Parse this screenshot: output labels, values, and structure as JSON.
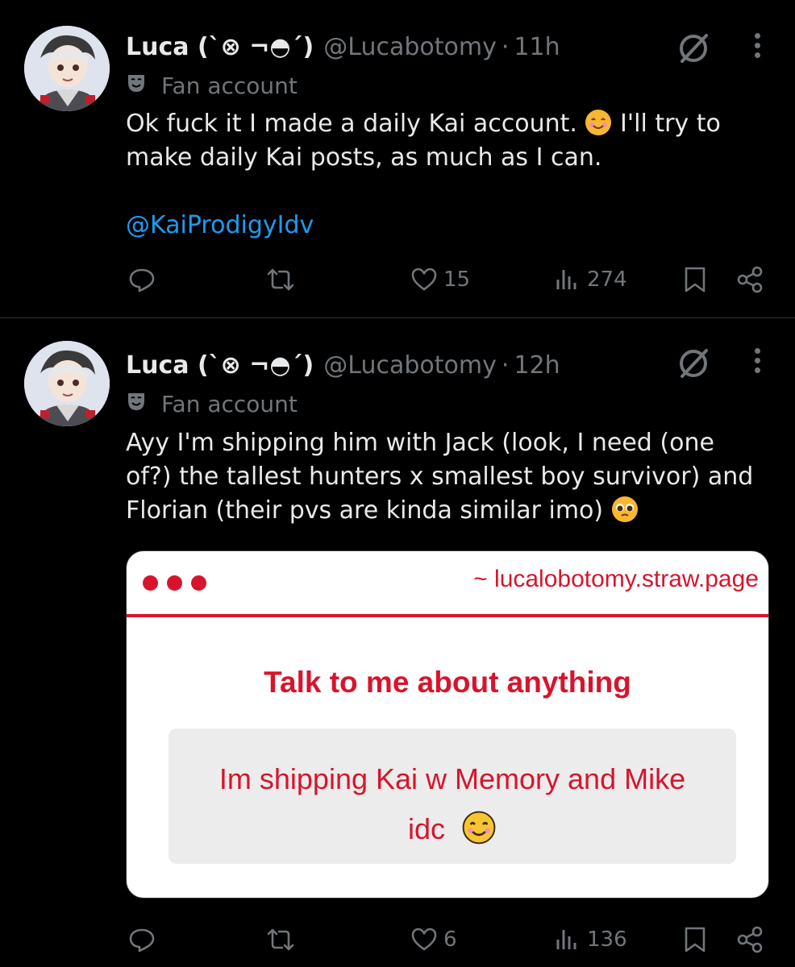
{
  "tweets": [
    {
      "author": {
        "name": "Luca (`⊗ ¬◓´)",
        "handle": "@Lucabotomy",
        "label": "Fan account"
      },
      "time": "11h",
      "text_line1": "Ok fuck it I made a daily Kai account.",
      "text_line1b": "I'll try to",
      "text_line2": "make daily Kai posts, as much as I can.",
      "mention": "@KaiProdigyIdv",
      "stats": {
        "replies": "",
        "reposts": "",
        "likes": "15",
        "views": "274"
      }
    },
    {
      "author": {
        "name": "Luca (`⊗ ¬◓´)",
        "handle": "@Lucabotomy",
        "label": "Fan account"
      },
      "time": "12h",
      "text_line1": "Ayy I'm shipping him with Jack (look, I need (one",
      "text_line2": "of?) the tallest hunters x smallest boy survivor) and",
      "text_line3": "Florian (their pvs are kinda similar imo)",
      "card": {
        "url": "~ lucalobotomy.straw.page",
        "title": "Talk to me about anything",
        "message_line1": "Im shipping Kai w Memory and Mike",
        "message_line2": "idc"
      },
      "stats": {
        "replies": "",
        "reposts": "",
        "likes": "6",
        "views": "136"
      }
    }
  ],
  "colors": {
    "background": "#000000",
    "text": "#e7e9ea",
    "muted": "#71767b",
    "link": "#1d9bf0",
    "card_accent": "#d8142c"
  },
  "icons": [
    "avatar",
    "grok-icon",
    "more-icon",
    "mask-icon",
    "reply-icon",
    "repost-icon",
    "like-icon",
    "views-icon",
    "bookmark-icon",
    "share-icon",
    "smiling-emoji",
    "pleading-emoji"
  ]
}
